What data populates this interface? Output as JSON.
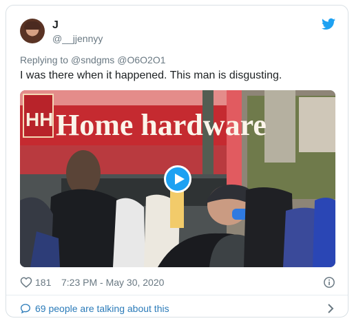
{
  "tweet": {
    "display_name": "J",
    "handle": "@__jjennyy",
    "replying_label": "Replying to",
    "mentions": [
      "@sndgms",
      "@O6O2O1"
    ],
    "text": "I was there when it happened. This man is disgusting.",
    "likes": "181",
    "timestamp": "7:23 PM - May 30, 2020",
    "talking": "69 people are talking about this",
    "accent_color": "#1da1f2",
    "link_color": "#2b7bb9"
  },
  "media": {
    "type": "video",
    "icon": "play-icon",
    "storefront_sign": "Home hardware",
    "storefront_logo": "HH"
  }
}
